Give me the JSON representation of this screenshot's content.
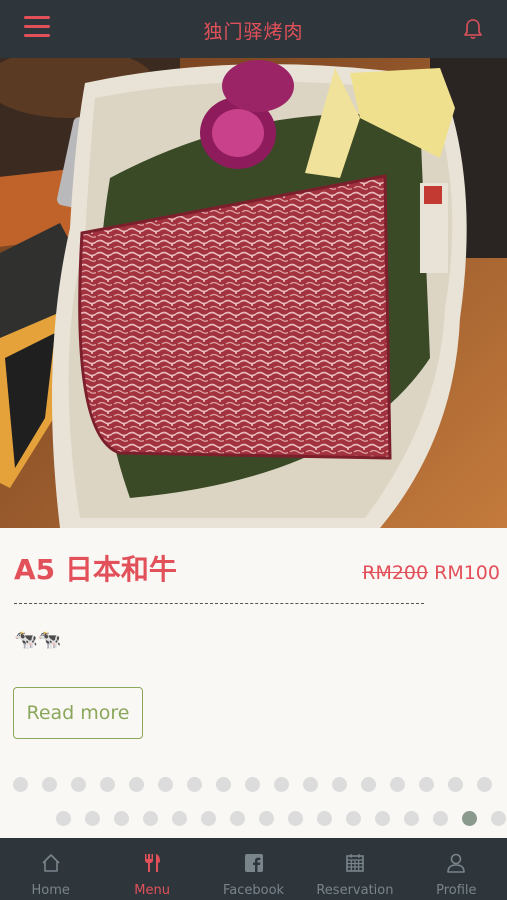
{
  "header": {
    "title": "独门驿烤肉",
    "menu_icon": "hamburger-menu-icon",
    "bell_icon": "bell-icon"
  },
  "hero": {
    "image": "photo of marbled A5 wagyu steak on a leaf-lined wooden plate with red onion and sliced potato",
    "plate_stamp_text": "独门驿"
  },
  "dish": {
    "title": "A5 日本和牛",
    "old_price": "RM200",
    "price": "RM100",
    "description": "🐄🐄",
    "read_more_label": "Read more"
  },
  "pagination": {
    "total": 33,
    "active_index": 31
  },
  "tabs": [
    {
      "label": "Home",
      "icon": "home-icon",
      "active": false
    },
    {
      "label": "Menu",
      "icon": "menu-utensils-icon",
      "active": true
    },
    {
      "label": "Facebook",
      "icon": "facebook-icon",
      "active": false
    },
    {
      "label": "Reservation",
      "icon": "calendar-icon",
      "active": false
    },
    {
      "label": "Profile",
      "icon": "profile-icon",
      "active": false
    }
  ],
  "colors": {
    "accent": "#e2505a",
    "bar_background": "#2e363c",
    "read_more": "#8aa75b",
    "inactive_tab": "#7a848b",
    "dot": "#dcdcdc",
    "dot_active": "#8a9a8c"
  }
}
